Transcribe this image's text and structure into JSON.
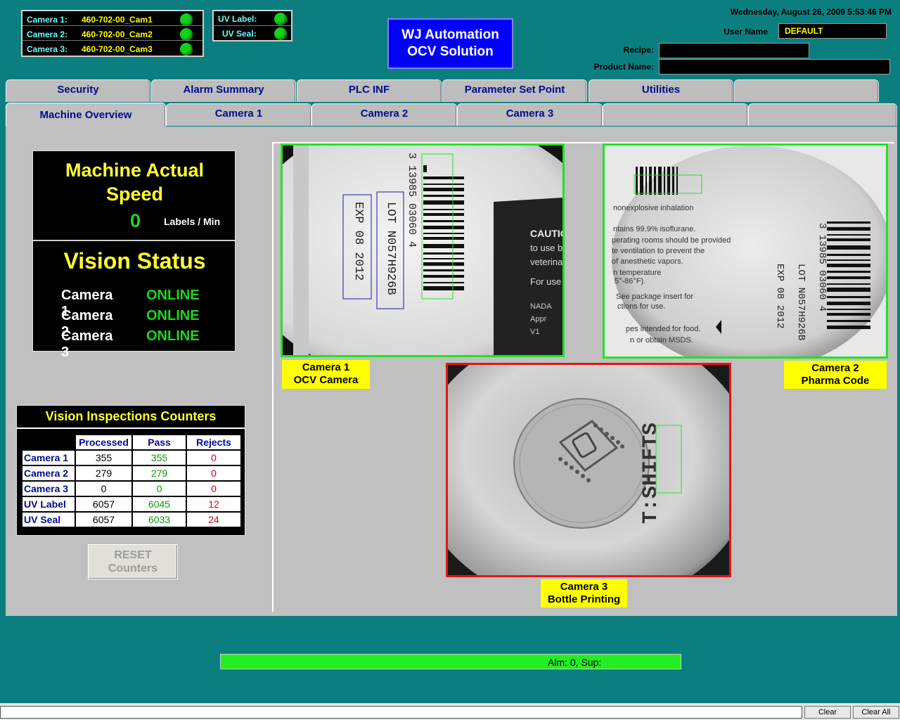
{
  "header": {
    "cameras": [
      {
        "label": "Camera 1:",
        "value": "460-702-00_Cam1"
      },
      {
        "label": "Camera 2:",
        "value": "460-702-00_Cam2"
      },
      {
        "label": "Camera 3:",
        "value": "460-702-00_Cam3"
      }
    ],
    "uv": [
      {
        "label": "UV Label:"
      },
      {
        "label": "UV Seal:"
      }
    ],
    "brand_line1": "WJ Automation",
    "brand_line2": "OCV Solution",
    "datetime": "Wednesday, August 26, 2009  5:53:46 PM",
    "user_name_label": "User Name",
    "user_name_value": "DEFAULT",
    "recipe_label": "Recipe:",
    "recipe_value": "",
    "product_name_label": "Product Name:",
    "product_name_value": "",
    "status_color": "#15d11a",
    "brand_color": "#0000ff"
  },
  "tabs_top": [
    "Security",
    "Alarm Summary",
    "PLC INF",
    "Parameter Set Point",
    "Utilities",
    ""
  ],
  "tabs_bottom": [
    "Machine Overview",
    "Camera 1",
    "Camera 2",
    "Camera 3",
    "",
    ""
  ],
  "active_tab": "Machine Overview",
  "speed": {
    "title_line1": "Machine Actual",
    "title_line2": "Speed",
    "value": "0",
    "unit": "Labels / Min"
  },
  "vision_status": {
    "title": "Vision Status",
    "rows": [
      {
        "camera": "Camera 1",
        "status": "ONLINE"
      },
      {
        "camera": "Camera 2",
        "status": "ONLINE"
      },
      {
        "camera": "Camera 3",
        "status": "ONLINE"
      }
    ]
  },
  "counters": {
    "title": "Vision Inspections Counters",
    "headers": [
      "Processed",
      "Pass",
      "Rejects"
    ],
    "rows": [
      {
        "name": "Camera 1",
        "processed": "355",
        "pass": "355",
        "rejects": "0"
      },
      {
        "name": "Camera 2",
        "processed": "279",
        "pass": "279",
        "rejects": "0"
      },
      {
        "name": "Camera 3",
        "processed": "0",
        "pass": "0",
        "rejects": "0"
      },
      {
        "name": "UV Label",
        "processed": "6057",
        "pass": "6045",
        "rejects": "12"
      },
      {
        "name": " UV Seal",
        "processed": "6057",
        "pass": "6033",
        "rejects": "24"
      }
    ],
    "reset_line1": "RESET",
    "reset_line2": "Counters"
  },
  "camera_views": {
    "cam1_line1": "Camera 1",
    "cam1_line2": "OCV Camera",
    "cam2_line1": "Camera 2",
    "cam2_line2": "Pharma Code",
    "cam3_line1": "Camera 3",
    "cam3_line2": "Bottle Printing",
    "cam1_text": {
      "barcode_num": "3  13985  03060  4",
      "exp": "EXP 08 2012",
      "lot": "LOT N057H926B",
      "caution": "CAUTIO",
      "lines": [
        "to use b",
        "veterina",
        "For use",
        "NADA",
        "Appr",
        "V1"
      ]
    },
    "cam2_text": {
      "lines": [
        "nonexplosive inhalation",
        "ntains 99.9% isoflurane.",
        "perating rooms should be provided",
        "te ventilation to prevent the",
        "of anesthetic vapors.",
        "n temperature",
        "5°-86°F).",
        "See package insert for",
        "ctions for use.",
        "pes intended for food.",
        "n or obtain MSDS."
      ],
      "lot": "LOT N057H926B",
      "exp": "EXP 08 2012",
      "barcode_num": "3  13985  03060  4"
    },
    "cam3_text": "T:SHIFTS"
  },
  "alarm": {
    "text": "Alm:    0, Sup:",
    "color": "#22ee22"
  },
  "footer": {
    "clear": "Clear",
    "clear_all": "Clear All"
  }
}
